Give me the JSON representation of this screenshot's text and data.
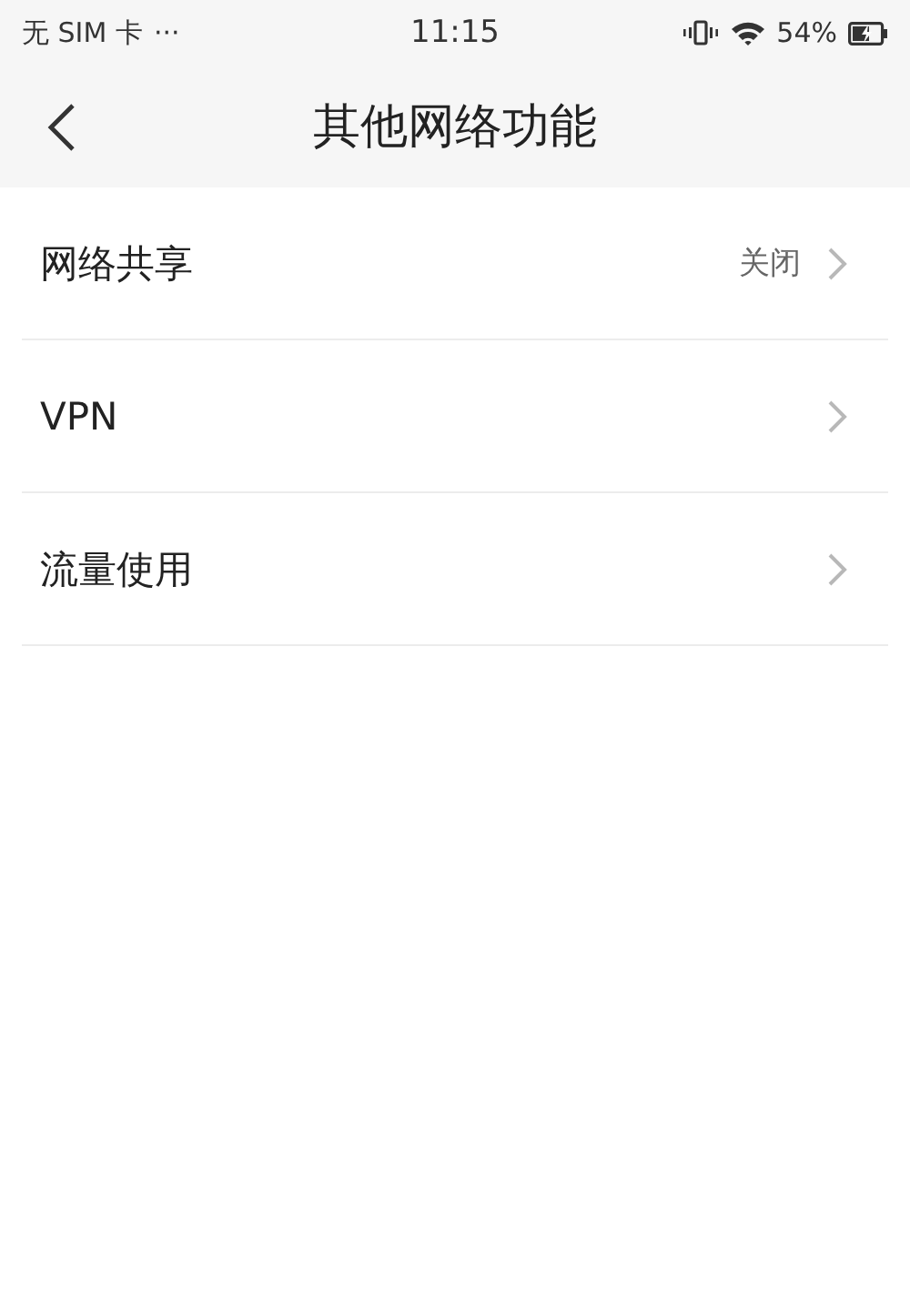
{
  "status_bar": {
    "carrier": "无 SIM 卡",
    "more": "···",
    "time": "11:15",
    "battery": "54%"
  },
  "header": {
    "title": "其他网络功能"
  },
  "items": [
    {
      "label": "网络共享",
      "value": "关闭"
    },
    {
      "label": "VPN"
    },
    {
      "label": "流量使用"
    }
  ]
}
